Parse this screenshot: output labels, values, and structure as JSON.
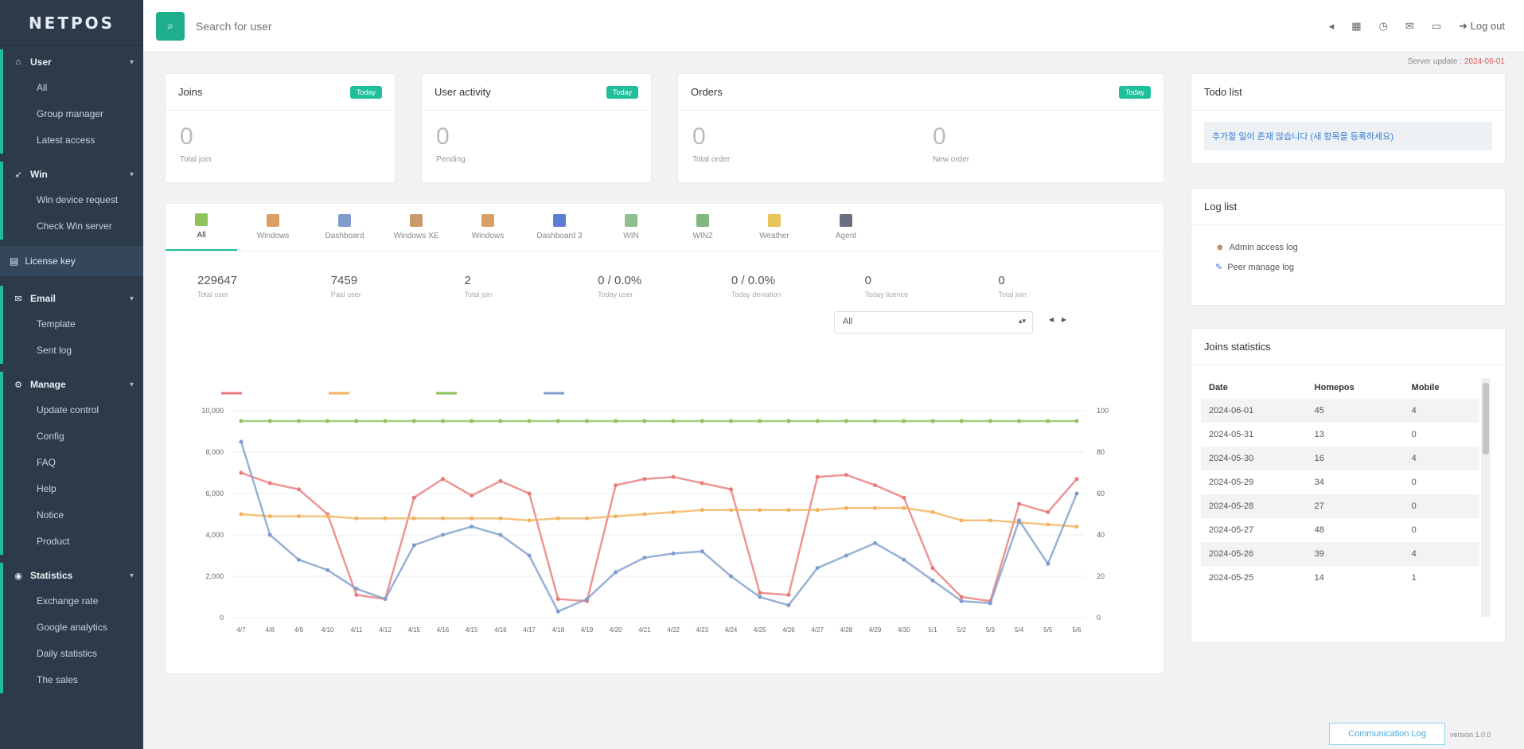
{
  "sidebar": {
    "logo": "NETPOS",
    "groups": [
      {
        "label": "User",
        "items": [
          "All",
          "Group manager",
          "Latest access"
        ]
      },
      {
        "label": "Win",
        "items": [
          "Win device request",
          "Check Win server"
        ]
      },
      {
        "label": "Email",
        "items": [
          "Template",
          "Sent log"
        ]
      },
      {
        "label": "Manage",
        "items": [
          "Update control",
          "Config",
          "FAQ",
          "Help",
          "Notice",
          "Product"
        ]
      },
      {
        "label": "Statistics",
        "items": [
          "Exchange rate",
          "Google analytics",
          "Daily statistics",
          "The sales"
        ]
      }
    ],
    "single": "License key"
  },
  "topbar": {
    "search_placeholder": "Search for user",
    "logout": "Log out"
  },
  "server_update": {
    "label": "Server update :",
    "value": "2024-06-01"
  },
  "cards": {
    "joins": {
      "title": "Joins",
      "badge": "Today",
      "value": "0",
      "label": "Total join"
    },
    "activity": {
      "title": "User activity",
      "badge": "Today",
      "value": "0",
      "label": "Pending"
    },
    "orders": {
      "title": "Orders",
      "badge": "Today",
      "value1": "0",
      "label1": "Total order",
      "value2": "0",
      "label2": "New order"
    }
  },
  "todo": {
    "title": "Todo list",
    "item": "추가할 일이 존재 않습니다 (새 항목을 등록하세요)"
  },
  "loglist": {
    "title": "Log list",
    "items": [
      "Admin access log",
      "Peer manage log"
    ]
  },
  "tabs": [
    "All",
    "Windows",
    "Dashboard",
    "Windows XE",
    "Windows",
    "Dashboard 3",
    "WIN",
    "WIN2",
    "Weather",
    "Agent"
  ],
  "kpis": [
    {
      "value": "229647",
      "label": "Total user"
    },
    {
      "value": "7459",
      "label": "Paid user"
    },
    {
      "value": "2",
      "label": "Total join"
    },
    {
      "value": "0 / 0.0%",
      "label": "Today user"
    },
    {
      "value": "0 / 0.0%",
      "label": "Today deviation"
    },
    {
      "value": "0",
      "label": "Today licence"
    },
    {
      "value": "0",
      "label": "Total join"
    }
  ],
  "select": {
    "value": "All"
  },
  "joins_stats": {
    "title": "Joins statistics",
    "headers": [
      "Date",
      "Homepos",
      "Mobile"
    ],
    "rows": [
      [
        "2024-06-01",
        "45",
        "4"
      ],
      [
        "2024-05-31",
        "13",
        "0"
      ],
      [
        "2024-05-30",
        "16",
        "4"
      ],
      [
        "2024-05-29",
        "34",
        "0"
      ],
      [
        "2024-05-28",
        "27",
        "0"
      ],
      [
        "2024-05-27",
        "48",
        "0"
      ],
      [
        "2024-05-26",
        "39",
        "4"
      ],
      [
        "2024-05-25",
        "14",
        "1"
      ]
    ]
  },
  "footer": {
    "comm_log": "Communication Log",
    "version": "version 1.0.0"
  },
  "chart_data": {
    "type": "line",
    "categories": [
      "4/7",
      "4/8",
      "4/9",
      "4/10",
      "4/11",
      "4/12",
      "4/15",
      "4/16",
      "4/15",
      "4/16",
      "4/17",
      "4/18",
      "4/19",
      "4/20",
      "4/21",
      "4/22",
      "4/23",
      "4/24",
      "4/25",
      "4/26",
      "4/27",
      "4/28",
      "4/29",
      "4/30",
      "5/1",
      "5/2",
      "5/3",
      "5/4",
      "5/5",
      "5/6"
    ],
    "y_left": {
      "ylim": [
        0,
        10000
      ],
      "ticks": [
        "0",
        "2,000",
        "4,000",
        "6,000",
        "8,000",
        "10,000"
      ]
    },
    "y_right": {
      "ylim": [
        0,
        100
      ],
      "ticks": [
        "0",
        "20",
        "40",
        "60",
        "80",
        "100"
      ]
    },
    "series": [
      {
        "color": "#e87a7a",
        "axis": "left",
        "values": [
          7000,
          6500,
          6200,
          5000,
          1100,
          900,
          5800,
          6700,
          5900,
          6600,
          6000,
          900,
          800,
          6400,
          6700,
          6800,
          6500,
          6200,
          1200,
          1100,
          6800,
          6900,
          6400,
          5800,
          2400,
          1000,
          800,
          5500,
          5100,
          6700
        ]
      },
      {
        "color": "#f2b35c",
        "axis": "right",
        "values": [
          50,
          49,
          49,
          49,
          48,
          48,
          48,
          48,
          48,
          48,
          47,
          48,
          48,
          49,
          50,
          51,
          52,
          52,
          52,
          52,
          52,
          53,
          53,
          53,
          51,
          47,
          47,
          46,
          45,
          44
        ]
      },
      {
        "color": "#8ec25a",
        "axis": "right",
        "values": [
          95,
          95,
          95,
          95,
          95,
          95,
          95,
          95,
          95,
          95,
          95,
          95,
          95,
          95,
          95,
          95,
          95,
          95,
          95,
          95,
          95,
          95,
          95,
          95,
          95,
          95,
          95,
          95,
          95,
          95
        ]
      },
      {
        "color": "#7f9ccc",
        "axis": "left",
        "values": [
          8500,
          4000,
          2800,
          2300,
          1400,
          900,
          3500,
          4000,
          4400,
          4000,
          3000,
          300,
          900,
          2200,
          2900,
          3100,
          3200,
          2000,
          1000,
          600,
          2400,
          3000,
          3600,
          2800,
          1800,
          800,
          700,
          4700,
          2600,
          6000
        ]
      }
    ]
  }
}
